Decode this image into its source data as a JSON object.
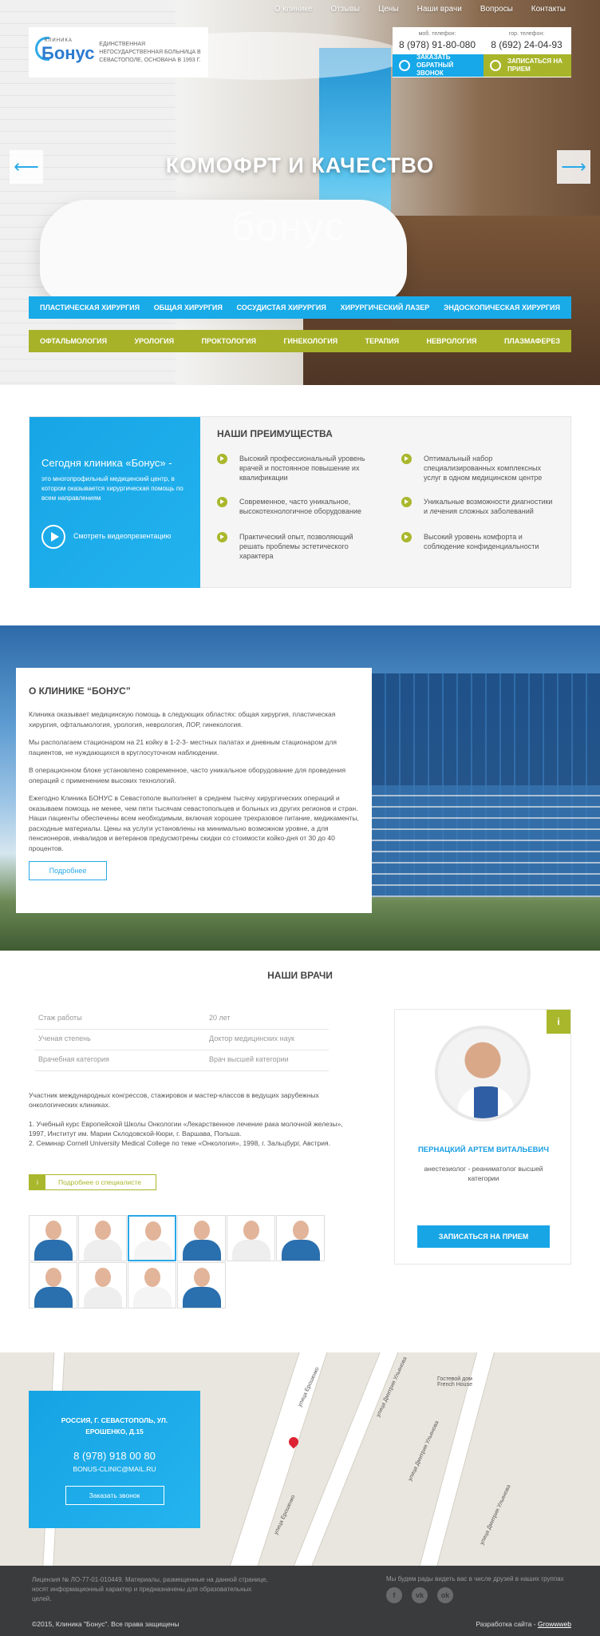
{
  "nav": [
    "О клинике",
    "Отзывы",
    "Цены",
    "Наши врачи",
    "Вопросы",
    "Контакты"
  ],
  "logo": {
    "small": "КЛИНИКА",
    "big": "Бонус",
    "desc": "Единственная негосударственная больница в Севастополе, основана в 1993 г."
  },
  "phones": [
    {
      "label": "моб. телефон:",
      "number": "8 (978) 91-80-080"
    },
    {
      "label": "гор. телефон:",
      "number": "8 (692) 24-04-93"
    }
  ],
  "buttons": {
    "callback": "Заказать обратный звонок",
    "appointment": "Записаться на прием"
  },
  "hero": {
    "title": "КОМОФРТ И КАЧЕСТВО",
    "brand": "бонус",
    "arrow_left": "⟵",
    "arrow_right": "⟶"
  },
  "services_row1": [
    "Пластическая хирургия",
    "Общая хирургия",
    "Сосудистая хирургия",
    "Хирургический лазер",
    "Эндоскопическая хирургия"
  ],
  "services_row2": [
    "Офтальмология",
    "Урология",
    "Проктология",
    "Гинекология",
    "Терапия",
    "Неврология",
    "Плазмаферез"
  ],
  "advantages": {
    "intro_title": "Сегодня клиника «Бонус» -",
    "intro_text": "это многопрофильный медицинский центр, в котором оказывается хирургическая помощь по всем направлениям",
    "video_label": "Смотреть видеопрезентацию",
    "title": "НАШИ ПРЕИМУЩЕСТВА",
    "items": [
      "Высокий профессиональный уровень врачей и постоянное повышение их квалификации",
      "Оптимальный набор специализированных комплексных услуг в одном медицинском центре",
      "Современное, часто уникальное, высокотехнологичное оборудование",
      "Уникальные возможности диагностики и лечения сложных заболеваний",
      "Практический опыт, позволяющий решать проблемы эстетического характера",
      "Высокий уровень комфорта и соблюдение конфиденциальности"
    ]
  },
  "about": {
    "title": "О КЛИНИКЕ “БОНУС”",
    "paragraphs": [
      "Клиника оказывает медицинскую помощь в следующих областях: общая хирургия, пластическая хирургия, офтальмология, урология, неврология, ЛОР, гинекология.",
      "Мы располагаем стационаром на 21 койку в 1-2-3- местных палатах и дневным стационаром для пациентов, не нуждающихся в круглосуточном наблюдении.",
      "В операционном блоке установлено современное, часто уникальное оборудование для проведения операций с применением высоких технологий.",
      "Ежегодно Клиника БОНУС в Севастополе выполняет в среднем тысячу хирургических операций и оказываем помощь не менее, чем пяти тысячам севастопольцев и больных из других регионов и стран. Наши пациенты обеспечены всем необходимым, включая хорошее трехразовое питание, медикаменты, расходные материалы. Цены на услуги установлены на минимально возможном уровне, а для пенсионеров, инвалидов и ветеранов предусмотрены скидки со стоимости койко-дня от 30 до 40 процентов."
    ],
    "button": "Подробнее"
  },
  "doctors": {
    "title": "НАШИ ВРАЧИ",
    "stats": [
      {
        "label": "Стаж работы",
        "value": "20 лет"
      },
      {
        "label": "Ученая степень",
        "value": "Доктор медицинских наук"
      },
      {
        "label": "Врачебная категория",
        "value": "Врач высшей категории"
      }
    ],
    "text1": "Участник международных конгрессов, стажировок и мастер-классов в ведущих зарубежных онкологических клиниках.",
    "text2": "1.      Учебный курс Европейской Школы Онкологии «Лекарственное лечение рака молочной железы», 1997, Институт им. Марии Склодовской-Кюри, г. Варшава, Польша.",
    "text3": "2.      Семинар Cornell University Medical College по теме «Онкология», 1998, г. Зальцбург, Австрия.",
    "more": "Подробнее о специалисте",
    "more_icon": "i",
    "card": {
      "name": "ПЕРНАЦКИЙ АРТЕМ ВИТАЛЬЕВИЧ",
      "role": "анестезиолог - реаниматолог высшей категории",
      "button": "ЗАПИСАТЬСЯ НА ПРИЕМ",
      "corner": "i"
    }
  },
  "map": {
    "address": "РОССИЯ, Г. СЕВАСТОПОЛЬ, УЛ. ЕРОШЕНКО, Д.15",
    "phone": "8 (978) 918 00 80",
    "email": "BONUS-CLINIC@MAIL.RU",
    "button": "Заказать звонок",
    "streets": [
      "улица Ерошенко",
      "улица Ерошенко",
      "улица Дмитрия Ульянова",
      "улица Дмитрия Ульянова",
      "улица Дмитрия Ульянова"
    ],
    "poi": "Гостевой дом French House"
  },
  "footer": {
    "license": "Лицензия № ЛО-77-01-010449. Материалы, размещенные на данной странице, носят информационный характер и предназначены для образовательных целей.",
    "social_text": "Мы будем рады видеть вас в числе друзей в наших группах",
    "social": [
      "f",
      "vk",
      "ok"
    ],
    "copyright": "©2015, Клиника \"Бонус\". Все права защищены",
    "dev_label": "Разработка сайта - ",
    "dev_link": "Growwweb"
  }
}
